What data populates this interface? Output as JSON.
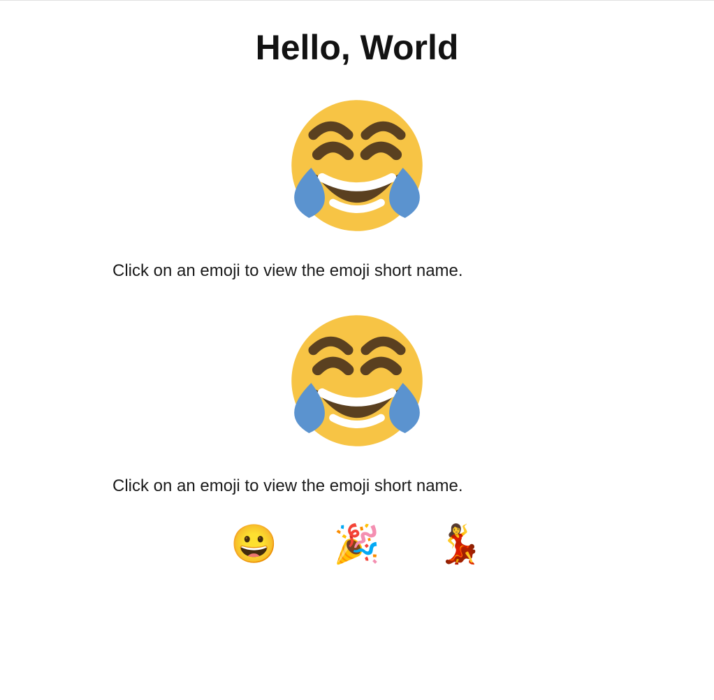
{
  "title": "Hello, World",
  "sections": [
    {
      "big_emoji_name": "face-with-tears-of-joy",
      "instruction": "Click on an emoji to view the emoji short name."
    },
    {
      "big_emoji_name": "face-with-tears-of-joy",
      "instruction": "Click on an emoji to view the emoji short name."
    }
  ],
  "emoji_row": [
    {
      "name": "grinning-face",
      "glyph": "😀"
    },
    {
      "name": "party-popper",
      "glyph": "🎉"
    },
    {
      "name": "woman-dancing",
      "glyph": "💃"
    }
  ]
}
